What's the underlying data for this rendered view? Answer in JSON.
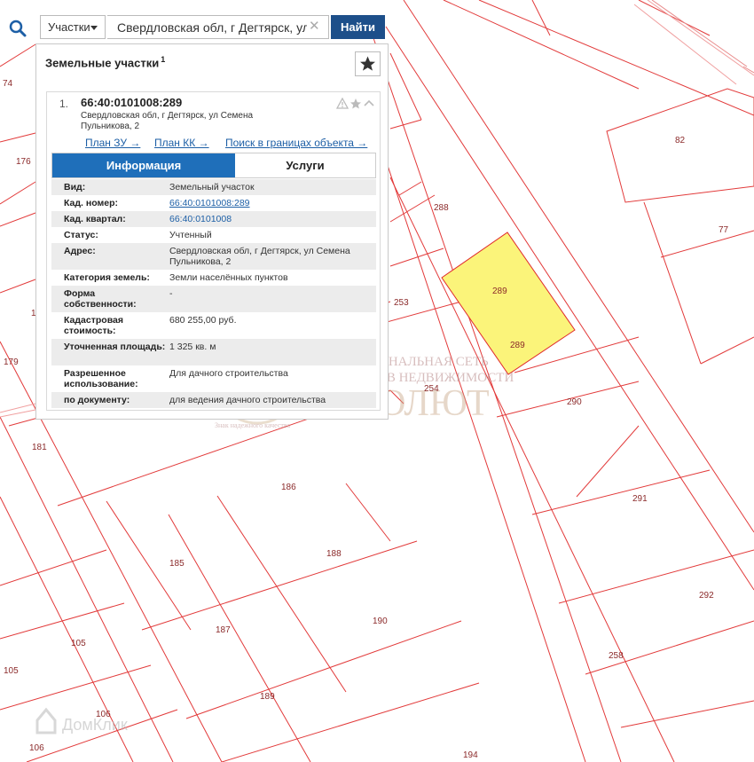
{
  "search": {
    "layer": "Участки",
    "query": "Свердловская обл, г Дегтярск, ул",
    "clear_glyph": "✕",
    "button": "Найти"
  },
  "panel": {
    "title": "Земельные участки",
    "count": "1",
    "item": {
      "index": "1.",
      "cadastral_number": "66:40:0101008:289",
      "address": "Свердловская обл, г Дегтярск, ул Семена Пульникова, 2",
      "links": [
        "План ЗУ →",
        "План КК →",
        "Поиск в границах объекта →"
      ]
    },
    "tabs": {
      "info": "Информация",
      "services": "Услуги"
    },
    "rows": [
      {
        "label": "Вид:",
        "value": "Земельный участок"
      },
      {
        "label": "Кад. номер:",
        "value": "66:40:0101008:289"
      },
      {
        "label": "Кад. квартал:",
        "value": "66:40:0101008"
      },
      {
        "label": "Статус:",
        "value": "Учтенный"
      },
      {
        "label": "Адрес:",
        "value": "Свердловская обл, г Дегтярск, ул Семена Пульникова, 2"
      },
      {
        "label": "Категория земель:",
        "value": "Земли населённых пунктов"
      },
      {
        "label": "Форма собственности:",
        "value": "-"
      },
      {
        "label": "Кадастровая стоимость:",
        "value": "680 255,00 руб."
      },
      {
        "label": "Уточненная площадь:",
        "value": "1 325 кв. м"
      },
      {
        "label": "Разрешенное использование:",
        "value": "Для дачного строительства"
      },
      {
        "label": "по документу:",
        "value": "для ведения дачного строительства"
      }
    ]
  },
  "map": {
    "plot_numbers": [
      "74",
      "176",
      "1",
      "179",
      "181",
      "82",
      "77",
      "288",
      "253",
      "289",
      "289",
      "254",
      "290",
      "291",
      "186",
      "185",
      "188",
      "187",
      "190",
      "292",
      "258",
      "105",
      "105",
      "106",
      "106",
      "189",
      "194"
    ],
    "watermark": {
      "line1": "РЕГИОНАЛЬНАЯ СЕТЬ",
      "line2": "АГЕНТСТВ НЕДВИЖИМОСТИ",
      "brand": "АБСОЛЮТ",
      "motto": "Знак надежного качества"
    },
    "corner_brand": "ДомКлик"
  },
  "colors": {
    "accent": "#1f6fba",
    "button": "#1d4f8a",
    "boundary": "#e02b2b",
    "selected_fill": "#fbf47a"
  }
}
